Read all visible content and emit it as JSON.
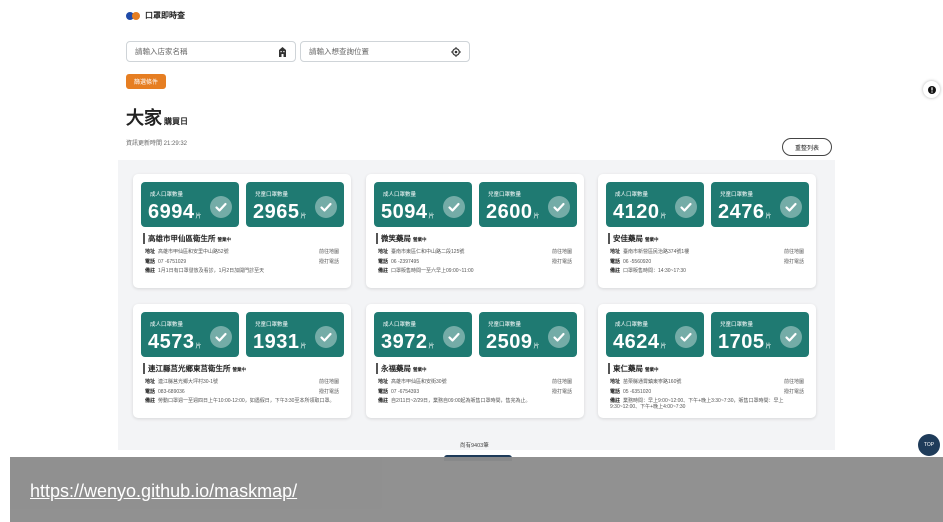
{
  "app": {
    "title": "口罩即時查",
    "dot_colors": [
      "#1f4aa8",
      "#e67e22"
    ]
  },
  "search": {
    "store_placeholder": "請輸入店家名稱",
    "location_placeholder": "請輸入想查詢位置"
  },
  "filter_button": "篩選條件",
  "headline": {
    "big": "大家",
    "small": "購買日"
  },
  "updated": "資訊更新時間 21:29:32",
  "reorder_button": "重整列表",
  "labels": {
    "adult": "成人口罩數量",
    "child": "兒童口罩數量",
    "unit": "片",
    "status": "營業中",
    "address": "地址",
    "phone": "電話",
    "note": "備註",
    "view_map": "前往地圖",
    "call": "撥打電話"
  },
  "pharmacies": [
    {
      "name": "高雄市甲仙區衛生所",
      "adult": 6994,
      "child": 2965,
      "address": "高雄市甲仙區和安里中山路52號",
      "phone": "07 -6751029",
      "note": "1月1日有口罩發放及看診，1月2日加開門診至天"
    },
    {
      "name": "微笑藥局",
      "adult": 5094,
      "child": 2600,
      "address": "臺南市東區仁和中山路二段125號",
      "phone": "06 -2397495",
      "note": "口罩販售時間一至六早上09:00~11:00"
    },
    {
      "name": "安佳藥局",
      "adult": 4120,
      "child": 2476,
      "address": "臺南市新營區民治路374號1樓",
      "phone": "06 -5560920",
      "note": "口罩販售時間：14:30~17:30"
    },
    {
      "name": "連江縣莒光鄉東莒衛生所",
      "adult": 4573,
      "child": 1931,
      "address": "連江縣莒光鄉大坪村30-1號",
      "phone": "083-689036",
      "note": "勞動口罩週一至週四日上午10:00-12:00，如遇假日，下午3:30至本所領取口罩。"
    },
    {
      "name": "永福藥局",
      "adult": 3972,
      "child": 2509,
      "address": "高雄市甲仙區和安街30號",
      "phone": "07 -6754393",
      "note": "自2/11日~2/29日，業務自09:00起為販售口罩時間，售完為止。"
    },
    {
      "name": "東仁藥局",
      "adult": 4624,
      "child": 1705,
      "address": "苗栗縣通霄鎮東寧路160號",
      "phone": "05 -6351020",
      "note": "業務時間：早上9:00~12:00、下午+晚上3:30~7:30，販售口罩時間：早上9:30~12:00、下午+晚上4:00~7:30"
    }
  ],
  "pager": "尚有9403筆",
  "top_button": "TOP",
  "banner_url": "https://wenyo.github.io/maskmap/"
}
